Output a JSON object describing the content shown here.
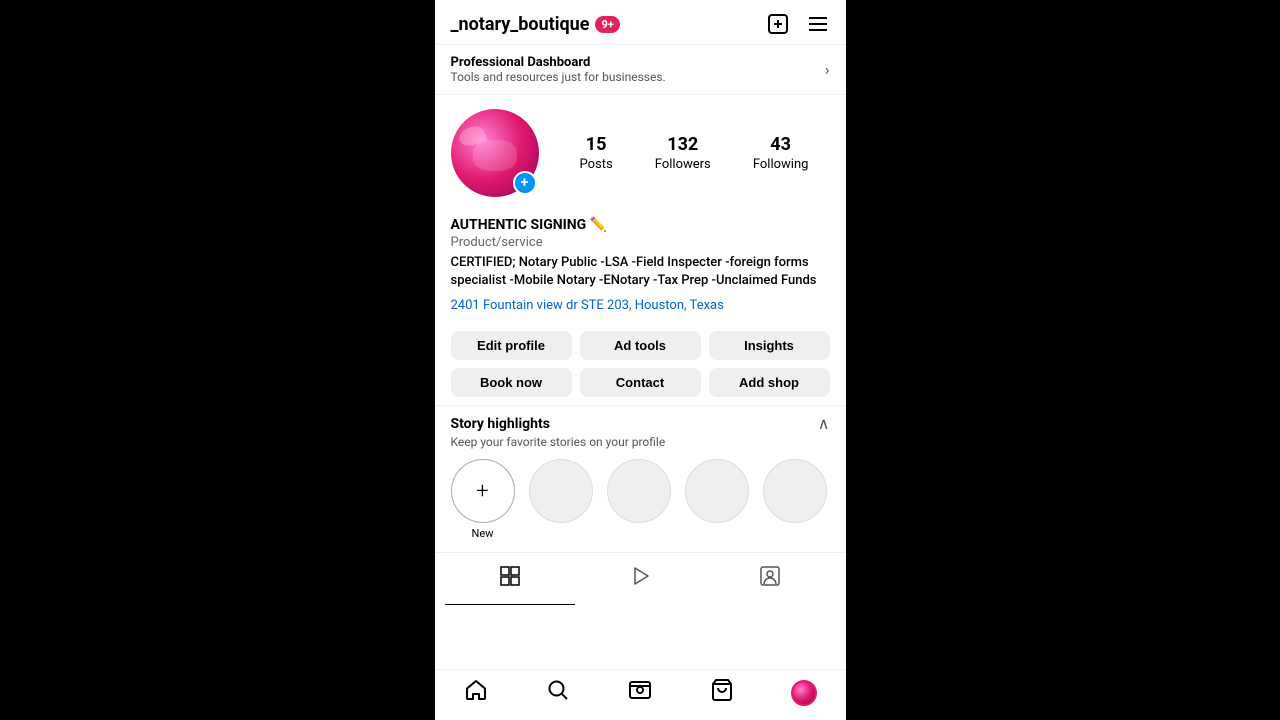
{
  "header": {
    "username": "_notary_boutique",
    "notification_count": "9+",
    "add_post_icon": "➕",
    "menu_icon": "☰"
  },
  "pro_dashboard": {
    "title": "Professional Dashboard",
    "subtitle": "Tools and resources just for businesses.",
    "arrow": "›"
  },
  "profile": {
    "posts_count": "15",
    "posts_label": "Posts",
    "followers_count": "132",
    "followers_label": "Followers",
    "following_count": "43",
    "following_label": "Following",
    "display_name": "AUTHENTIC SIGNING ✏️",
    "category": "Product/service",
    "bio": "CERTIFIED; Notary Public -LSA -Field Inspecter -foreign forms specialist -Mobile Notary -ENotary -Tax Prep -Unclaimed Funds",
    "location": "2401 Fountain view dr STE 203, Houston, Texas"
  },
  "action_buttons": {
    "row1": {
      "edit_profile": "Edit profile",
      "ad_tools": "Ad tools",
      "insights": "Insights"
    },
    "row2": {
      "book_now": "Book now",
      "contact": "Contact",
      "add_shop": "Add shop"
    }
  },
  "highlights": {
    "title": "Story highlights",
    "subtitle": "Keep your favorite stories on your profile",
    "new_label": "New",
    "chevron": "∧"
  },
  "content_tabs": {
    "grid_icon": "⊞",
    "reels_icon": "▷",
    "tagged_icon": "👤"
  },
  "bottom_nav": {
    "home": "🏠",
    "search": "🔍",
    "reels": "🎬",
    "shop": "🛍",
    "profile": "profile_avatar"
  }
}
